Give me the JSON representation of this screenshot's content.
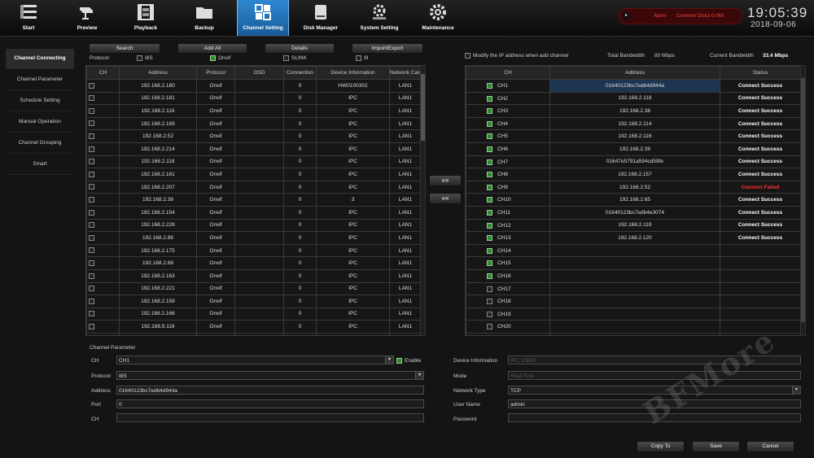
{
  "nav": [
    {
      "label": "Start",
      "icon": "grid-icon"
    },
    {
      "label": "Preview",
      "icon": "camera-icon"
    },
    {
      "label": "Playback",
      "icon": "film-icon"
    },
    {
      "label": "Backup",
      "icon": "folder-icon"
    },
    {
      "label": "Channel Setting",
      "icon": "network-icon"
    },
    {
      "label": "Disk Manager",
      "icon": "disk-icon"
    },
    {
      "label": "System Setting",
      "icon": "gears-icon"
    },
    {
      "label": "Maintenance",
      "icon": "gear-icon"
    }
  ],
  "alarm": {
    "label": "Alarm",
    "message": "Common Disk1-0-0Mi"
  },
  "clock": {
    "time": "19:05:39",
    "date": "2018-09-06"
  },
  "sidebar": [
    {
      "label": "Channel Connecting"
    },
    {
      "label": "Channel Parameter"
    },
    {
      "label": "Schedule Setting"
    },
    {
      "label": "Manual Operation"
    },
    {
      "label": "Channel Grouping"
    },
    {
      "label": "Smart"
    }
  ],
  "toolbar": {
    "search": "Search",
    "add_all": "Add All",
    "details": "Details",
    "import_export": "Import/Export"
  },
  "protocol": {
    "label": "Protocol",
    "options": [
      "I8S",
      "Onvif",
      "SLINK",
      "I9"
    ]
  },
  "left_table": {
    "headers": [
      "CH",
      "Address",
      "Protocol",
      "OSD",
      "Connection",
      "Device Information",
      "Network Card"
    ],
    "rows": [
      [
        "192.168.2.180",
        "Onvif",
        "",
        "0",
        "HW0100302",
        "LAN1"
      ],
      [
        "192.168.2.181",
        "Onvif",
        "",
        "0",
        "IPC",
        "LAN1"
      ],
      [
        "192.168.2.116",
        "Onvif",
        "",
        "0",
        "IPC",
        "LAN1"
      ],
      [
        "192.168.2.169",
        "Onvif",
        "",
        "0",
        "IPC",
        "LAN1"
      ],
      [
        "192.168.2.52",
        "Onvif",
        "",
        "0",
        "IPC",
        "LAN1"
      ],
      [
        "192.168.2.214",
        "Onvif",
        "",
        "0",
        "IPC",
        "LAN1"
      ],
      [
        "192.168.2.118",
        "Onvif",
        "",
        "0",
        "IPC",
        "LAN1"
      ],
      [
        "192.168.2.161",
        "Onvif",
        "",
        "0",
        "IPC",
        "LAN1"
      ],
      [
        "192.168.2.207",
        "Onvif",
        "",
        "0",
        "IPC",
        "LAN1"
      ],
      [
        "192.168.2.38",
        "Onvif",
        "",
        "0",
        "3",
        "LAN1"
      ],
      [
        "192.168.2.154",
        "Onvif",
        "",
        "0",
        "IPC",
        "LAN1"
      ],
      [
        "192.168.2.228",
        "Onvif",
        "",
        "0",
        "IPC",
        "LAN1"
      ],
      [
        "192.168.2.88",
        "Onvif",
        "",
        "0",
        "IPC",
        "LAN1"
      ],
      [
        "192.168.2.175",
        "Onvif",
        "",
        "0",
        "IPC",
        "LAN1"
      ],
      [
        "192.168.2.68",
        "Onvif",
        "",
        "0",
        "IPC",
        "LAN1"
      ],
      [
        "192.168.2.163",
        "Onvif",
        "",
        "0",
        "IPC",
        "LAN1"
      ],
      [
        "192.168.2.221",
        "Onvif",
        "",
        "0",
        "IPC",
        "LAN1"
      ],
      [
        "192.168.2.158",
        "Onvif",
        "",
        "0",
        "IPC",
        "LAN1"
      ],
      [
        "192.168.2.166",
        "Onvif",
        "",
        "0",
        "IPC",
        "LAN1"
      ],
      [
        "192.168.9.116",
        "Onvif",
        "",
        "0",
        "IPC",
        "LAN1"
      ],
      [
        "",
        "",
        "",
        "",
        "",
        ""
      ]
    ]
  },
  "arrows": {
    "add": "»»",
    "remove": "««"
  },
  "modify_ip": "Modify the IP address when add channel",
  "bandwidth": {
    "total_label": "Total Bandwidth",
    "total_value": "80 Mbps",
    "current_label": "Current Bandwidth",
    "current_value": "33.4 Mbps"
  },
  "right_table": {
    "headers": [
      "CH",
      "Address",
      "Status"
    ],
    "rows": [
      {
        "ch": "CH1",
        "checked": true,
        "address": "01640123bc7edb4d944a",
        "status": "Connect Success",
        "state": "ok"
      },
      {
        "ch": "CH2",
        "checked": true,
        "address": "192.168.2.118",
        "status": "Connect Success",
        "state": "ok"
      },
      {
        "ch": "CH3",
        "checked": true,
        "address": "192.168.2.38",
        "status": "Connect Success",
        "state": "ok"
      },
      {
        "ch": "CH4",
        "checked": true,
        "address": "192.168.2.114",
        "status": "Connect Success",
        "state": "ok"
      },
      {
        "ch": "CH5",
        "checked": true,
        "address": "192.168.2.116",
        "status": "Connect Success",
        "state": "ok"
      },
      {
        "ch": "CH6",
        "checked": true,
        "address": "192.168.2.39",
        "status": "Connect Success",
        "state": "ok"
      },
      {
        "ch": "CH7",
        "checked": true,
        "address": "01647e5791a594cd59fe",
        "status": "Connect Success",
        "state": "ok"
      },
      {
        "ch": "CH8",
        "checked": true,
        "address": "192.168.2.157",
        "status": "Connect Success",
        "state": "ok"
      },
      {
        "ch": "CH9",
        "checked": true,
        "address": "192.168.2.52",
        "status": "Connect Failed",
        "state": "fail"
      },
      {
        "ch": "CH10",
        "checked": true,
        "address": "192.168.2.65",
        "status": "Connect Success",
        "state": "ok"
      },
      {
        "ch": "CH11",
        "checked": true,
        "address": "01640123bc7edb4e3074",
        "status": "Connect Success",
        "state": "ok"
      },
      {
        "ch": "CH12",
        "checked": true,
        "address": "192.168.2.119",
        "status": "Connect Success",
        "state": "ok"
      },
      {
        "ch": "CH13",
        "checked": true,
        "address": "192.168.2.120",
        "status": "Connect Success",
        "state": "ok"
      },
      {
        "ch": "CH14",
        "checked": true,
        "address": "",
        "status": "",
        "state": ""
      },
      {
        "ch": "CH15",
        "checked": true,
        "address": "",
        "status": "",
        "state": ""
      },
      {
        "ch": "CH16",
        "checked": true,
        "address": "",
        "status": "",
        "state": ""
      },
      {
        "ch": "CH17",
        "checked": false,
        "address": "",
        "status": "",
        "state": ""
      },
      {
        "ch": "CH18",
        "checked": false,
        "address": "",
        "status": "",
        "state": ""
      },
      {
        "ch": "CH19",
        "checked": false,
        "address": "",
        "status": "",
        "state": ""
      },
      {
        "ch": "CH20",
        "checked": false,
        "address": "",
        "status": "",
        "state": ""
      },
      {
        "ch": "",
        "checked": false,
        "address": "",
        "status": "",
        "state": ""
      }
    ]
  },
  "params": {
    "title": "Channel Parameter",
    "ch_label": "CH",
    "ch_value": "CH1",
    "enable_label": "Enable",
    "protocol_label": "Protocol",
    "protocol_value": "I8S",
    "address_label": "Address",
    "address_value": "01640123bc7edb4d944a",
    "port_label": "Port",
    "port_value": "0",
    "ch2_label": "CH",
    "ch2_value": "",
    "device_info_label": "Device Information",
    "device_info_value": "IPC,1080P",
    "mode_label": "Mode",
    "mode_value": "Real Time",
    "network_type_label": "Network Type",
    "network_type_value": "TCP",
    "user_label": "User Name",
    "user_value": "admin",
    "password_label": "Password",
    "password_value": ""
  },
  "footer": {
    "copy": "Copy To",
    "save": "Save",
    "cancel": "Cancel"
  },
  "watermark": "BFMore",
  "colors": {
    "accent": "#2a7fd0",
    "fail": "#ff3030",
    "alarm": "#ff3a3a"
  }
}
